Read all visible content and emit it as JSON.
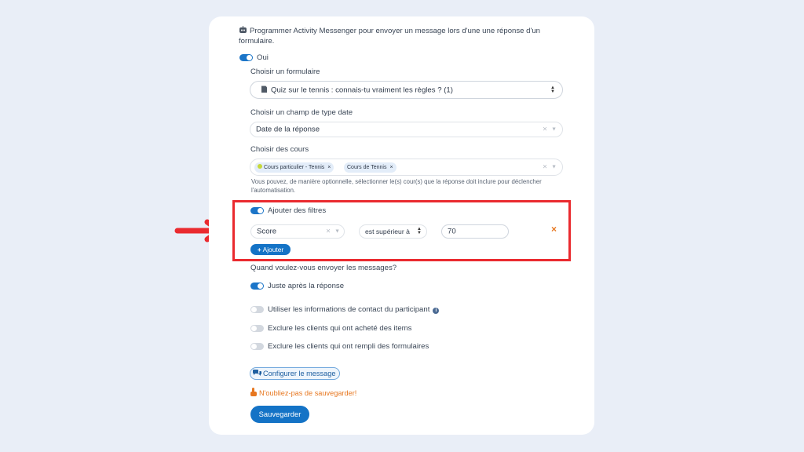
{
  "intro": {
    "text": "Programmer Activity Messenger pour envoyer un message lors d'une une réponse d'un formulaire."
  },
  "main_toggle": {
    "label": "Oui",
    "on": true
  },
  "form_select": {
    "label": "Choisir un formulaire",
    "value": "Quiz sur le tennis : connais-tu vraiment les règles ? (1)"
  },
  "date_field": {
    "label": "Choisir un champ de type date",
    "value": "Date de la réponse"
  },
  "courses": {
    "label": "Choisir des cours",
    "chips": [
      "Cours particulier - Tennis",
      "Cours de Tennis"
    ],
    "help": "Vous pouvez, de manière optionnelle, sélectionner le(s) cour(s) que la réponse doit inclure pour déclencher l'automatisation."
  },
  "filters": {
    "toggle_label": "Ajouter des filtres",
    "on": true,
    "field": "Score",
    "operator": "est supérieur à",
    "value": "70",
    "remove": "×",
    "add_label": "Ajouter"
  },
  "when": {
    "label": "Quand voulez-vous envoyer les messages?",
    "toggles": [
      {
        "label": "Juste après la réponse",
        "on": true
      },
      {
        "label": "Utiliser les informations de contact du participant",
        "on": false
      },
      {
        "label": "Exclure les clients qui ont acheté des items",
        "on": false
      },
      {
        "label": "Exclure les clients qui ont rempli des formulaires",
        "on": false
      }
    ]
  },
  "configure": {
    "label": "Configurer le message"
  },
  "warning": {
    "text": "N'oubliez-pas de sauvegarder!"
  },
  "save": {
    "label": "Sauvegarder"
  },
  "colors": {
    "primary": "#1473c6",
    "highlight": "#ea2a2f",
    "warning": "#e77720",
    "background": "#e9eef7"
  },
  "icons": [
    "robot-icon",
    "document-icon",
    "info-icon",
    "chat-icon",
    "hand-icon",
    "arrow-right-icon",
    "plus-icon"
  ]
}
